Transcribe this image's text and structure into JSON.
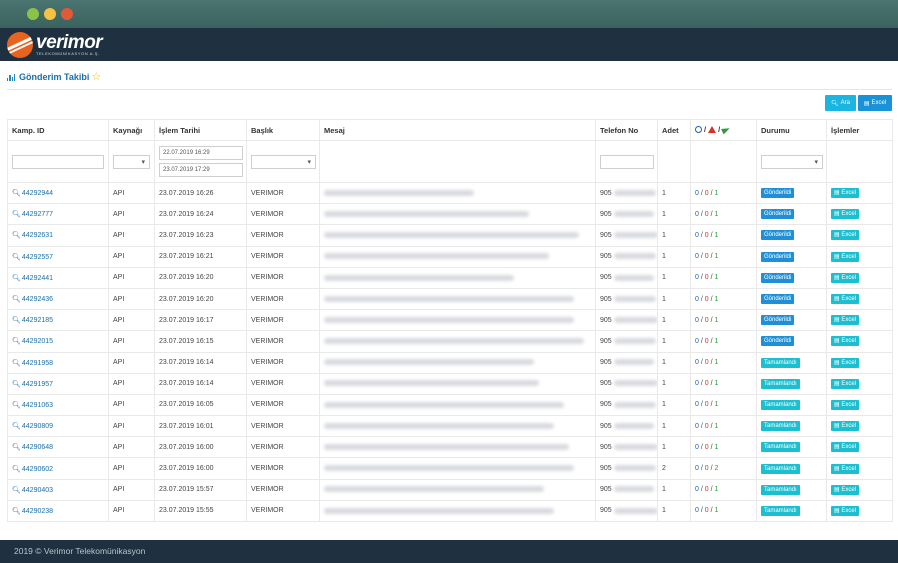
{
  "brand": {
    "name": "verimor",
    "sub": "TELEKOMÜNİKASYON A.Ş."
  },
  "page": {
    "title": "Gönderim Takibi",
    "star_icon": "star-outline-icon"
  },
  "toolbar": {
    "search_label": "Ara",
    "excel_label": "Excel"
  },
  "columns": {
    "id": "Kamp. ID",
    "source": "Kaynağı",
    "date": "İşlem Tarihi",
    "title": "Başlık",
    "message": "Mesaj",
    "phone": "Telefon No",
    "count": "Adet",
    "status": "Durumu",
    "actions": "İşlemler"
  },
  "filters": {
    "date_from": "22.07.2019 16:29",
    "date_to": "23.07.2019 17:29"
  },
  "colors": {
    "accent": "#1a6fa8",
    "sent": "#1f90d8",
    "done": "#1bbfd0",
    "header": "#1f3140"
  },
  "rows": [
    {
      "id": "44292944",
      "source": "API",
      "date": "23.07.2019 16:26",
      "title": "VERIMOR",
      "phone_prefix": "905",
      "count": "1",
      "c1": "0",
      "c2": "0",
      "c3": "1",
      "status": "Gönderildi",
      "status_type": "sent",
      "action": "Excel"
    },
    {
      "id": "44292777",
      "source": "API",
      "date": "23.07.2019 16:24",
      "title": "VERIMOR",
      "phone_prefix": "905",
      "count": "1",
      "c1": "0",
      "c2": "0",
      "c3": "1",
      "status": "Gönderildi",
      "status_type": "sent",
      "action": "Excel"
    },
    {
      "id": "44292631",
      "source": "API",
      "date": "23.07.2019 16:23",
      "title": "VERIMOR",
      "phone_prefix": "905",
      "count": "1",
      "c1": "0",
      "c2": "0",
      "c3": "1",
      "status": "Gönderildi",
      "status_type": "sent",
      "action": "Excel"
    },
    {
      "id": "44292557",
      "source": "API",
      "date": "23.07.2019 16:21",
      "title": "VERIMOR",
      "phone_prefix": "905",
      "count": "1",
      "c1": "0",
      "c2": "0",
      "c3": "1",
      "status": "Gönderildi",
      "status_type": "sent",
      "action": "Excel"
    },
    {
      "id": "44292441",
      "source": "API",
      "date": "23.07.2019 16:20",
      "title": "VERIMOR",
      "phone_prefix": "905",
      "count": "1",
      "c1": "0",
      "c2": "0",
      "c3": "1",
      "status": "Gönderildi",
      "status_type": "sent",
      "action": "Excel"
    },
    {
      "id": "44292436",
      "source": "API",
      "date": "23.07.2019 16:20",
      "title": "VERIMOR",
      "phone_prefix": "905",
      "count": "1",
      "c1": "0",
      "c2": "0",
      "c3": "1",
      "status": "Gönderildi",
      "status_type": "sent",
      "action": "Excel"
    },
    {
      "id": "44292185",
      "source": "API",
      "date": "23.07.2019 16:17",
      "title": "VERIMOR",
      "phone_prefix": "905",
      "count": "1",
      "c1": "0",
      "c2": "0",
      "c3": "1",
      "status": "Gönderildi",
      "status_type": "sent",
      "action": "Excel"
    },
    {
      "id": "44292015",
      "source": "API",
      "date": "23.07.2019 16:15",
      "title": "VERIMOR",
      "phone_prefix": "905",
      "count": "1",
      "c1": "0",
      "c2": "0",
      "c3": "1",
      "status": "Gönderildi",
      "status_type": "sent",
      "action": "Excel"
    },
    {
      "id": "44291958",
      "source": "API",
      "date": "23.07.2019 16:14",
      "title": "VERIMOR",
      "phone_prefix": "905",
      "count": "1",
      "c1": "0",
      "c2": "0",
      "c3": "1",
      "status": "Tamamlandı",
      "status_type": "done",
      "action": "Excel"
    },
    {
      "id": "44291957",
      "source": "API",
      "date": "23.07.2019 16:14",
      "title": "VERIMOR",
      "phone_prefix": "905",
      "count": "1",
      "c1": "0",
      "c2": "0",
      "c3": "1",
      "status": "Tamamlandı",
      "status_type": "done",
      "action": "Excel"
    },
    {
      "id": "44291063",
      "source": "API",
      "date": "23.07.2019 16:05",
      "title": "VERIMOR",
      "phone_prefix": "905",
      "count": "1",
      "c1": "0",
      "c2": "0",
      "c3": "1",
      "status": "Tamamlandı",
      "status_type": "done",
      "action": "Excel"
    },
    {
      "id": "44290809",
      "source": "API",
      "date": "23.07.2019 16:01",
      "title": "VERIMOR",
      "phone_prefix": "905",
      "count": "1",
      "c1": "0",
      "c2": "0",
      "c3": "1",
      "status": "Tamamlandı",
      "status_type": "done",
      "action": "Excel"
    },
    {
      "id": "44290648",
      "source": "API",
      "date": "23.07.2019 16:00",
      "title": "VERIMOR",
      "phone_prefix": "905",
      "count": "1",
      "c1": "0",
      "c2": "0",
      "c3": "1",
      "status": "Tamamlandı",
      "status_type": "done",
      "action": "Excel"
    },
    {
      "id": "44290602",
      "source": "API",
      "date": "23.07.2019 16:00",
      "title": "VERIMOR",
      "phone_prefix": "905",
      "count": "2",
      "c1": "0",
      "c2": "0",
      "c3": "2",
      "status": "Tamamlandı",
      "status_type": "done",
      "action": "Excel"
    },
    {
      "id": "44290403",
      "source": "API",
      "date": "23.07.2019 15:57",
      "title": "VERIMOR",
      "phone_prefix": "905",
      "count": "1",
      "c1": "0",
      "c2": "0",
      "c3": "1",
      "status": "Tamamlandı",
      "status_type": "done",
      "action": "Excel"
    },
    {
      "id": "44290238",
      "source": "API",
      "date": "23.07.2019 15:55",
      "title": "VERIMOR",
      "phone_prefix": "905",
      "count": "1",
      "c1": "0",
      "c2": "0",
      "c3": "1",
      "status": "Tamamlandı",
      "status_type": "done",
      "action": "Excel"
    }
  ],
  "footer": {
    "text": "2019 © Verimor Telekomünikasyon"
  }
}
